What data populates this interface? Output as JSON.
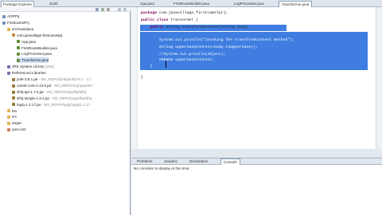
{
  "package_explorer": {
    "tabs": [
      "Package Explorer",
      "JUnit"
    ],
    "tree": [
      {
        "label": "AOPPrj",
        "icon": "project",
        "indent": 0
      },
      {
        "label": "FirstCamelPrj",
        "icon": "project",
        "indent": 0
      },
      {
        "label": "src/main/java",
        "icon": "folder",
        "indent": 1
      },
      {
        "label": "com.javavillage.firstcamelprj",
        "icon": "package",
        "indent": 2
      },
      {
        "label": "App.java",
        "icon": "java",
        "indent": 3
      },
      {
        "label": "FirstRouteBuilder.java",
        "icon": "java",
        "indent": 3
      },
      {
        "label": "LogProcessor.java",
        "icon": "java",
        "indent": 3
      },
      {
        "label": "Transformer.java",
        "icon": "java",
        "indent": 3,
        "selected": true
      },
      {
        "label": "JRE System Library",
        "suffix": " [JDK]",
        "icon": "library",
        "indent": 1
      },
      {
        "label": "Referenced Libraries",
        "icon": "library",
        "indent": 1
      },
      {
        "label": "junit-3.8.1.jar",
        "suffix": " - M2_REPO/junit/junit/3.8.1 - C:\\",
        "icon": "jar",
        "indent": 2
      },
      {
        "label": "camel-core-2.13.0.jar",
        "suffix": " - M2_REPO/org/apache/",
        "icon": "jar",
        "indent": 2
      },
      {
        "label": "slf4j-api-1.7.5.jar",
        "suffix": " - M2_REPO/org/slf4j/slf4j-",
        "icon": "jar",
        "indent": 2
      },
      {
        "label": "slf4j-simple-1.6.4.jar",
        "suffix": " - M2_REPO/org/slf4j/slf4j-",
        "icon": "jar",
        "indent": 2
      },
      {
        "label": "log4j-1.2.17.jar",
        "suffix": " - M2_REPO/log4j/log4j/1.2.17",
        "icon": "jar",
        "indent": 2
      },
      {
        "label": "bin",
        "icon": "folder",
        "indent": 1
      },
      {
        "label": "src",
        "icon": "folder",
        "indent": 1
      },
      {
        "label": "target",
        "icon": "folder",
        "indent": 1
      },
      {
        "label": "pom.xml",
        "icon": "xml",
        "indent": 1
      }
    ]
  },
  "editor": {
    "tabs": [
      "App.java",
      "FirstRouteBuilder.java",
      "LogProcessor.java",
      "Transformer.java"
    ],
    "active_tab": 3,
    "lines": [
      {
        "parts": [
          [
            "kw",
            "package"
          ],
          [
            "plain",
            " com.javavillage.firstcamelprj;"
          ]
        ]
      },
      {
        "parts": [
          [
            "plain",
            ""
          ]
        ]
      },
      {
        "parts": [
          [
            "kw",
            "public class"
          ],
          [
            "plain",
            " Transormer {"
          ]
        ]
      },
      {
        "parts": [
          [
            "plain",
            "    "
          ],
          [
            "kw",
            "public"
          ],
          [
            "plain",
            " String transformContent(String body)"
          ]
        ],
        "selected_partial": true
      },
      {
        "parts": [
          [
            "plain",
            ""
          ]
        ],
        "selected": true
      },
      {
        "parts": [
          [
            "plain",
            "        System."
          ],
          [
            "plain",
            "out"
          ],
          [
            "plain",
            ".println("
          ],
          [
            "str",
            "\"invoking the transformContent method\""
          ],
          [
            "plain",
            ");"
          ]
        ],
        "selected": true
      },
      {
        "parts": [
          [
            "plain",
            "        String upperCaseContent=body.toUpperCase();"
          ]
        ],
        "selected": true
      },
      {
        "parts": [
          [
            "plain",
            "        "
          ],
          [
            "cmt",
            "//System.out.println(object);"
          ]
        ],
        "selected": true
      },
      {
        "parts": [
          [
            "plain",
            "        "
          ],
          [
            "kw",
            "return"
          ],
          [
            "plain",
            " upperCaseContent;"
          ]
        ],
        "selected": true
      },
      {
        "parts": [
          [
            "plain",
            "    }"
          ]
        ],
        "selected": true
      },
      {
        "parts": [
          [
            "plain",
            "}"
          ]
        ]
      }
    ]
  },
  "bottom_panel": {
    "tabs": [
      "Problems",
      "Javadoc",
      "Declaration",
      "Console"
    ],
    "active_tab": 3,
    "message": "No consoles to display at this time."
  },
  "colors": {
    "selection": "#3f7ee0",
    "keyword": "#7f0055",
    "string": "#2a00ff",
    "comment": "#3f7f5f"
  }
}
